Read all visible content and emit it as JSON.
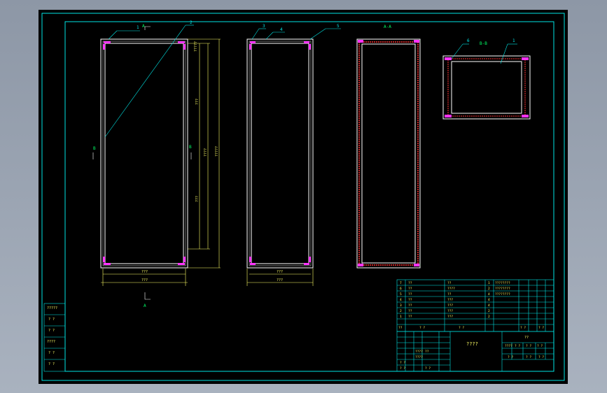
{
  "colors": {
    "border": "#00e5e5",
    "frame": "#ffffff",
    "callout": "#00e5e5",
    "dimension": "#ffff66",
    "bolt": "#ff33ff",
    "red": "#ff3333",
    "section_text": "#00ff66",
    "title_text": "#ffff66"
  },
  "views": {
    "front": {
      "callout_1": "1",
      "callout_2": "2",
      "section_a_top": "A",
      "section_a_bottom": "A",
      "section_b_left": "B",
      "section_b_right": "B",
      "dim_inner_width": "???",
      "dim_outer_width": "???",
      "dim_top_small": "?????",
      "dim_upper": "???",
      "dim_lower": "???",
      "dim_mid": "????",
      "dim_total": "?????"
    },
    "side": {
      "callout_3": "3",
      "callout_4": "4",
      "callout_5": "5",
      "dim_inner_width": "???",
      "dim_outer_width": "???"
    },
    "section_aa": {
      "label": "A-A"
    },
    "section_bb": {
      "label": "B-B",
      "callout_6": "6",
      "callout_1": "1"
    }
  },
  "bom": {
    "rows": [
      {
        "no": "7",
        "qty": "??",
        "mat": "??",
        "code": "1",
        "spec": "????????"
      },
      {
        "no": "6",
        "qty": "??",
        "mat": "????",
        "code": "2",
        "spec": "????????"
      },
      {
        "no": "5",
        "qty": "??",
        "mat": "??",
        "code": "4",
        "spec": "????????"
      },
      {
        "no": "4",
        "qty": "??",
        "mat": "???",
        "code": "4",
        "spec": ""
      },
      {
        "no": "3",
        "qty": "??",
        "mat": "???",
        "code": "4",
        "spec": ""
      },
      {
        "no": "2",
        "qty": "??",
        "mat": "???",
        "code": "2",
        "spec": ""
      },
      {
        "no": "1",
        "qty": "??",
        "mat": "???",
        "code": "2",
        "spec": ""
      }
    ],
    "header": {
      "no": "??",
      "name": "? ?",
      "mat": "? ?",
      "qty": "? ?",
      "note": "? ?"
    },
    "code_cells": [
      "? ?",
      "? ?"
    ]
  },
  "title_block": {
    "title": "????",
    "company": "??",
    "left_cells": [
      "????",
      "????",
      "??",
      "? ?",
      "? ?",
      "? ?"
    ],
    "right_top": [
      "????",
      "? ?",
      "? ?",
      "? ?"
    ],
    "right_bottom": [
      "? ?",
      "? ?",
      "? ?"
    ]
  },
  "revision_table": {
    "cells": [
      "?????",
      "? ?",
      "? ?",
      "????",
      "? ?",
      "? ?"
    ]
  }
}
